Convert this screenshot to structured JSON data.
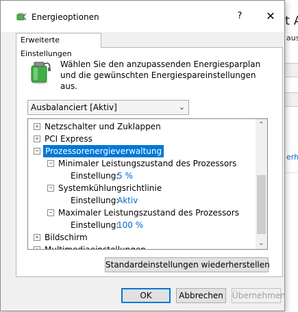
{
  "background_window": {
    "title_fragment": "t Au",
    "label_fragment": "aus",
    "link_fragment": "erh"
  },
  "dialog": {
    "title": "Energieoptionen",
    "help_label": "?",
    "close_label": "✕",
    "tab_label": "Erweiterte Einstellungen",
    "description": "Wählen Sie den anzupassenden Energiesparplan und die gewünschten Energiespareinstellungen aus.",
    "plan_select": {
      "selected": "Ausbalanciert [Aktiv]"
    },
    "tree": {
      "rows": [
        {
          "expander": "+",
          "label": "Netzschalter und Zuklappen"
        },
        {
          "expander": "+",
          "label": "PCI Express"
        },
        {
          "expander": "−",
          "label": "Prozessorenergieverwaltung"
        },
        {
          "expander": "−",
          "label": "Minimaler Leistungszustand des Prozessors"
        },
        {
          "label": "Einstellung:",
          "value": "5 %"
        },
        {
          "expander": "−",
          "label": "Systemkühlungsrichtlinie"
        },
        {
          "label": "Einstellung:",
          "value": "Aktiv"
        },
        {
          "expander": "−",
          "label": "Maximaler Leistungszustand des Prozessors"
        },
        {
          "label": "Einstellung:",
          "value": "100 %"
        },
        {
          "expander": "+",
          "label": "Bildschirm"
        },
        {
          "expander": "+",
          "label": "Multimediaeinstellungen"
        }
      ]
    },
    "restore_label": "Standardeinstellungen wiederherstellen",
    "ok_label": "OK",
    "cancel_label": "Abbrechen",
    "apply_label": "Übernehmen"
  },
  "colors": {
    "selection": "#0078d7",
    "value_link": "#0066cc",
    "dialog_bg": "#f0f0f0"
  },
  "icons": {
    "title": "power-options-icon",
    "header": "battery-plug-icon"
  }
}
